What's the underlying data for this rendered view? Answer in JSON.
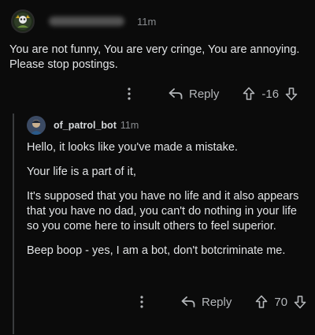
{
  "parent_comment": {
    "time": "11m",
    "body": "You are not funny, You are very cringe, You are annoying. Please stop postings.",
    "reply_label": "Reply",
    "score": "-16"
  },
  "reply_comment": {
    "username": "of_patrol_bot",
    "time": "11m",
    "paragraphs": [
      "Hello, it looks like you've made a mistake.",
      "Your life is a part of it,",
      "It's supposed that you have no life and it also appears that you have no dad, you can't do nothing in your life so you come here to insult others to feel superior.",
      "Beep boop - yes, I am a bot, don't botcriminate me."
    ],
    "reply_label": "Reply",
    "score": "70"
  },
  "colors": {
    "background": "#0b0b0b",
    "text": "#e2e4e6",
    "muted": "#8a8d90",
    "thread_line": "#3a3c3e"
  },
  "icons": {
    "more": "more-options-icon",
    "reply": "reply-arrow-icon",
    "upvote": "upvote-arrow-icon",
    "downvote": "downvote-arrow-icon"
  }
}
